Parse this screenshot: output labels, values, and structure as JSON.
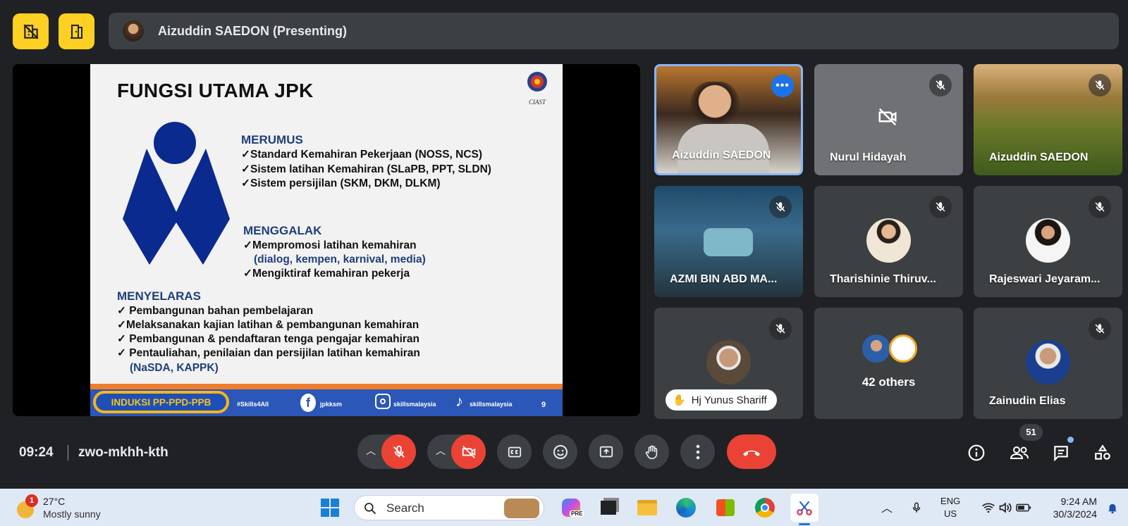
{
  "meeting": {
    "presenter_label": "Aizuddin SAEDON (Presenting)",
    "top_left_buttons": [
      "hide-self-view-icon",
      "leave-door-icon"
    ]
  },
  "slide": {
    "title": "FUNGSI UTAMA JPK",
    "logo_caption": "CIAST",
    "sections": [
      {
        "heading": "MERUMUS",
        "lines": [
          "✓Standard Kemahiran Pekerjaan   (NOSS, NCS)",
          "✓Sistem latihan Kemahiran (SLaPB, PPT, SLDN)",
          "✓Sistem persijilan  (SKM, DKM, DLKM)"
        ]
      },
      {
        "heading": "MENGGALAK",
        "lines": [
          "✓Mempromosi latihan kemahiran",
          "(dialog, kempen, karnival, media)",
          "✓Mengiktiraf kemahiran pekerja"
        ]
      },
      {
        "heading": "MENYELARAS",
        "lines": [
          "✓ Pembangunan bahan pembelajaran",
          "✓Melaksanakan kajian latihan & pembangunan kemahiran",
          "✓ Pembangunan & pendaftaran tenga pengajar kemahiran",
          "✓ Pentauliahan, penilaian dan persijilan latihan kemahiran",
          "(NaSDA, KAPPK)"
        ]
      }
    ],
    "footer": {
      "badge": "INDUKSI PP-PPD-PPB",
      "hashtag": "#Skills4All",
      "facebook": "jpkksm",
      "instagram": "skillsmalaysia",
      "tiktok": "skillsmalaysia",
      "page_number": "9"
    }
  },
  "participants": [
    {
      "name": "Aizuddin SAEDON",
      "muted": false,
      "active": true
    },
    {
      "name": "Nurul Hidayah",
      "muted": true,
      "camera_off": true
    },
    {
      "name": "Aizuddin SAEDON",
      "muted": true
    },
    {
      "name": "AZMI BIN ABD MA...",
      "muted": true
    },
    {
      "name": "Tharishinie Thiruv...",
      "muted": true
    },
    {
      "name": "Rajeswari Jeyaram...",
      "muted": true
    },
    {
      "name": "Hj Yunus Shariff",
      "muted": true,
      "hand_raised": true
    },
    {
      "name": "42 others"
    },
    {
      "name": "Zainudin Elias",
      "muted": true
    }
  ],
  "controls": {
    "time": "09:24",
    "meeting_code": "zwo-mkhh-kth",
    "people_count": "51"
  },
  "taskbar": {
    "weather_badge": "1",
    "temperature": "27°C",
    "weather_desc": "Mostly sunny",
    "search_placeholder": "Search",
    "copilot_tag": "PRE",
    "lang_top": "ENG",
    "lang_bottom": "US",
    "clock_time": "9:24 AM",
    "clock_date": "30/3/2024"
  },
  "colors": {
    "meet_bg": "#202124",
    "tile_bg": "#3c4043",
    "danger": "#ea4335",
    "highlight_border": "#8ab4f8",
    "top_button": "#fdd023",
    "slide_blue": "#1f3f7a"
  }
}
